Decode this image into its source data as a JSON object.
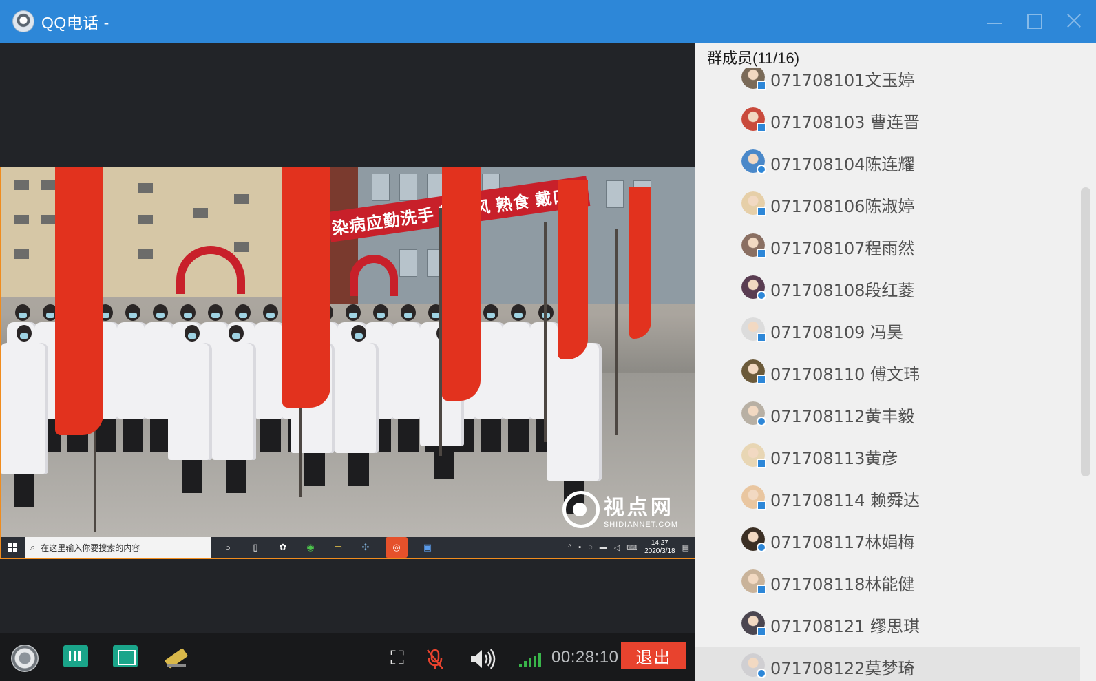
{
  "window": {
    "title": "QQ电话 -"
  },
  "shared_screen": {
    "banner_text": "染病应勤洗手  勤通风   熟食  戴口罩",
    "watermark_main": "视点网",
    "watermark_sub": "SHIDIANNET.COM",
    "taskbar": {
      "search_placeholder": "在这里输入你要搜索的内容",
      "time": "14:27",
      "date": "2020/3/18"
    }
  },
  "toolbar": {
    "timer": "00:28:10",
    "exit_label": "退出"
  },
  "panel": {
    "header": "群成员(11/16)",
    "members": [
      {
        "name": "071708101文玉婷",
        "avatar_color": "#7a6a58"
      },
      {
        "name": "071708103 曹连晋",
        "avatar_color": "#c94a3c"
      },
      {
        "name": "071708104陈连耀",
        "avatar_color": "#4a88c9"
      },
      {
        "name": "071708106陈淑婷",
        "avatar_color": "#e6cfa8"
      },
      {
        "name": "071708107程雨然",
        "avatar_color": "#8a6f62"
      },
      {
        "name": "071708108段红菱",
        "avatar_color": "#5a3d52"
      },
      {
        "name": "071708109 冯昊",
        "avatar_color": "#dcdcdc"
      },
      {
        "name": "071708110 傅文玮",
        "avatar_color": "#6b5a3a"
      },
      {
        "name": "071708112黄丰毅",
        "avatar_color": "#b8b0a4"
      },
      {
        "name": "071708113黄彦",
        "avatar_color": "#e8d6b4"
      },
      {
        "name": "071708114 赖舜达",
        "avatar_color": "#e9c6a0"
      },
      {
        "name": "071708117林娟梅",
        "avatar_color": "#3b2f24"
      },
      {
        "name": "071708118林能健",
        "avatar_color": "#c9b39a"
      },
      {
        "name": "071708121 缪思琪",
        "avatar_color": "#4b4650"
      },
      {
        "name": "071708122莫梦琦",
        "avatar_color": "#d0cfd2"
      }
    ]
  }
}
